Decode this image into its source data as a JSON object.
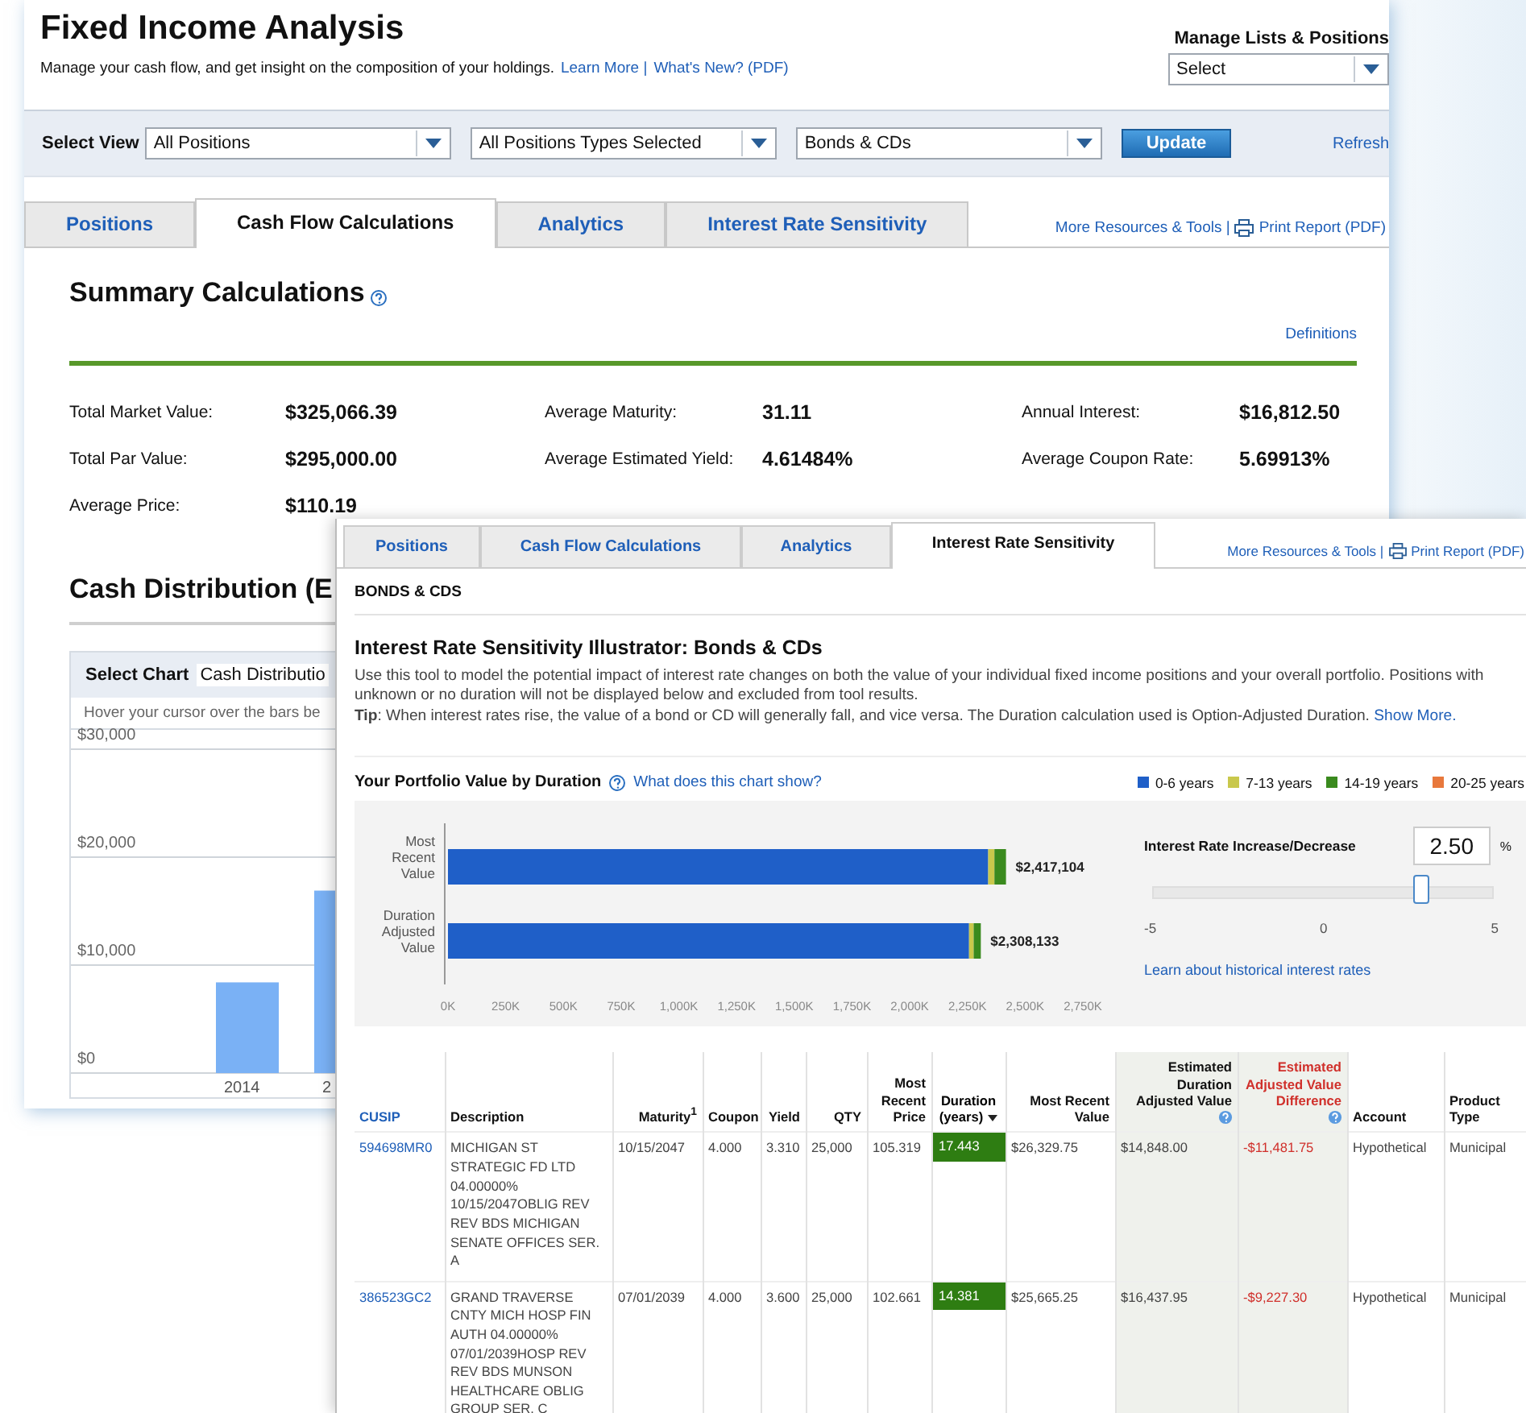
{
  "back_window": {
    "title": "Fixed Income Analysis",
    "subtitle": "Manage your cash flow, and get insight on the composition of your holdings.",
    "subtitle_links": [
      "Learn More |",
      "What's New? (PDF)"
    ],
    "manage": {
      "label": "Manage Lists & Positions",
      "value": "Select"
    },
    "view_bar": {
      "label": "Select View",
      "selects": [
        "All Positions",
        "All Positions Types Selected",
        "Bonds & CDs"
      ],
      "button": "Update",
      "refresh": "Refresh"
    },
    "tabs": [
      {
        "label": "Positions",
        "selected": false
      },
      {
        "label": "Cash Flow Calculations",
        "selected": true
      },
      {
        "label": "Analytics",
        "selected": false
      },
      {
        "label": "Interest Rate Sensitivity",
        "selected": false
      }
    ],
    "tab_links": {
      "resources": "More Resources & Tools |",
      "print": "Print Report (PDF)"
    },
    "summary": {
      "title": "Summary Calculations",
      "definitions": "Definitions",
      "stats": [
        {
          "label": "Total Market Value:",
          "value": "$325,066.39"
        },
        {
          "label": "Average Maturity:",
          "value": "31.11"
        },
        {
          "label": "Annual Interest:",
          "value": "$16,812.50"
        },
        {
          "label": "Total Par Value:",
          "value": "$295,000.00"
        },
        {
          "label": "Average Estimated Yield:",
          "value": "4.61484%"
        },
        {
          "label": "Average Coupon Rate:",
          "value": "5.69913%"
        },
        {
          "label": "Average Price:",
          "value": "$110.19"
        }
      ]
    },
    "cash_distribution": {
      "title": "Cash Distribution (E",
      "chart_label": "Select Chart",
      "chart_select": "Cash Distributio",
      "hint": "Hover your cursor over the bars be",
      "chart_data": {
        "type": "bar",
        "categories": [
          "2014",
          "2"
        ],
        "values": [
          8400,
          16900
        ],
        "ylim": [
          0,
          30000
        ],
        "yticks": [
          {
            "value": 0,
            "label": "$0"
          },
          {
            "value": 10000,
            "label": "$10,000"
          },
          {
            "value": 20000,
            "label": "$20,000"
          },
          {
            "value": 30000,
            "label": "$30,000"
          }
        ]
      }
    }
  },
  "front_window": {
    "tabs": [
      {
        "label": "Positions",
        "selected": false
      },
      {
        "label": "Cash Flow Calculations",
        "selected": false
      },
      {
        "label": "Analytics",
        "selected": false
      },
      {
        "label": "Interest Rate Sensitivity",
        "selected": true
      }
    ],
    "tab_links": {
      "resources": "More Resources & Tools |",
      "print": "Print Report (PDF)"
    },
    "section": "BONDS & CDS",
    "title": "Interest Rate Sensitivity Illustrator: Bonds & CDs",
    "intro": "Use this tool to model the potential impact of interest rate changes on both the value of your individual fixed income positions and your overall portfolio. Positions with unknown or no duration will not be displayed below and excluded from tool results.",
    "tip": "**Tip**: When interest rates rise, the value of a bond or CD will generally fall, and vice versa. The Duration calculation used is Option-Adjusted Duration.",
    "show_more": "Show More.",
    "chart_title": "Your Portfolio Value by Duration",
    "chart_help_link": "What does this chart show?",
    "chart_data": {
      "type": "bar",
      "orientation": "horizontal",
      "stacked": true,
      "categories": [
        "Most Recent Value",
        "Duration Adjusted Value"
      ],
      "series": [
        {
          "name": "0-6 years",
          "color": "#1f5fc8",
          "values": [
            2340000,
            2257000
          ]
        },
        {
          "name": "7-13 years",
          "color": "#c9c84c",
          "values": [
            27000,
            20000
          ]
        },
        {
          "name": "14-19 years",
          "color": "#3a8a1e",
          "values": [
            50000,
            31000
          ]
        },
        {
          "name": "20-25 years",
          "color": "#e8783c",
          "values": [
            0,
            0
          ]
        }
      ],
      "xlim": [
        0,
        2750000
      ],
      "xticks": [
        {
          "value": 0,
          "label": "0K"
        },
        {
          "value": 250000,
          "label": "250K"
        },
        {
          "value": 500000,
          "label": "500K"
        },
        {
          "value": 750000,
          "label": "750K"
        },
        {
          "value": 1000000,
          "label": "1,000K"
        },
        {
          "value": 1250000,
          "label": "1,250K"
        },
        {
          "value": 1500000,
          "label": "1,500K"
        },
        {
          "value": 1750000,
          "label": "1,750K"
        },
        {
          "value": 2000000,
          "label": "2,000K"
        },
        {
          "value": 2250000,
          "label": "2,250K"
        },
        {
          "value": 2500000,
          "label": "2,500K"
        },
        {
          "value": 2750000,
          "label": "2,750K"
        }
      ],
      "value_labels": [
        "$2,417,104",
        "$2,308,133"
      ]
    },
    "rate": {
      "label": "Interest Rate Increase/Decrease",
      "value": "2.50",
      "unit": "%",
      "level": 0.75,
      "ticks": [
        "-5",
        "0",
        "5"
      ],
      "link": "Learn about historical interest rates"
    },
    "table": {
      "columns": [
        {
          "label": "CUSIP",
          "kind": "link",
          "sorted": false,
          "highlighted": false,
          "help": false
        },
        {
          "label": "Description",
          "kind": "text",
          "sorted": false,
          "highlighted": false,
          "help": false
        },
        {
          "label": "Maturity$^{1}$",
          "kind": "date",
          "sorted": false,
          "highlighted": false,
          "help": false
        },
        {
          "label": "Coupon",
          "kind": "number",
          "sorted": false,
          "highlighted": false,
          "help": false
        },
        {
          "label": "Yield",
          "kind": "number",
          "sorted": false,
          "highlighted": false,
          "help": false
        },
        {
          "label": "QTY",
          "kind": "number",
          "sorted": false,
          "highlighted": false,
          "help": false
        },
        {
          "label": "Most Recent Price",
          "kind": "number",
          "sorted": false,
          "highlighted": false,
          "help": false
        },
        {
          "label": "Duration (years)",
          "kind": "duration",
          "sorted": true,
          "highlighted": false,
          "help": false
        },
        {
          "label": "Most Recent Value",
          "kind": "number",
          "sorted": false,
          "highlighted": false,
          "help": false
        },
        {
          "label": "Estimated Duration Adjusted Value",
          "kind": "number",
          "sorted": false,
          "highlighted": true,
          "help": true
        },
        {
          "label": "Estimated Adjusted Value Difference",
          "kind": "difference",
          "sorted": false,
          "highlighted": true,
          "help": true
        },
        {
          "label": "Account",
          "kind": "text",
          "sorted": false,
          "highlighted": false,
          "help": false
        },
        {
          "label": "Product Type",
          "kind": "text",
          "sorted": false,
          "highlighted": false,
          "help": false
        }
      ],
      "rows": [
        {
          "color": "#2e7d12",
          "cells": [
            "594698MR0",
            "MICHIGAN ST STRATEGIC FD LTD 04.00000% 10/15/2047OBLIG REV REV BDS MICHIGAN SENATE OFFICES SER. A",
            "10/15/2047",
            "4.000",
            "3.310",
            "25,000",
            "105.319",
            "17.443",
            "$26,329.75",
            "$14,848.00",
            "-$11,481.75",
            "Hypothetical",
            "Municipal"
          ]
        },
        {
          "color": "#2e7d12",
          "cells": [
            "386523GC2",
            "GRAND TRAVERSE CNTY MICH HOSP FIN AUTH 04.00000% 07/01/2039HOSP REV REV BDS MUNSON HEALTHCARE OBLIG GROUP SER. C",
            "07/01/2039",
            "4.000",
            "3.600",
            "25,000",
            "102.661",
            "14.381",
            "$25,665.25",
            "$16,437.95",
            "-$9,227.30",
            "Hypothetical",
            "Municipal"
          ]
        }
      ]
    }
  }
}
